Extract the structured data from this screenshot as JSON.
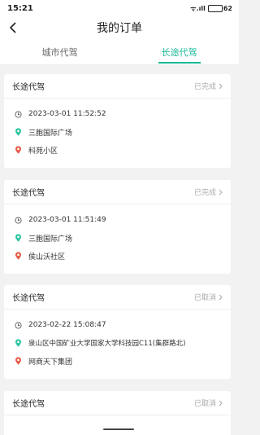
{
  "status_bar": {
    "time": "15:21",
    "signal_text": "ᯤ.ıll",
    "battery_level": "62"
  },
  "header": {
    "title": "我的订单"
  },
  "tabs": [
    {
      "label": "城市代驾",
      "active": false
    },
    {
      "label": "长途代驾",
      "active": true
    }
  ],
  "orders": [
    {
      "type": "长途代驾",
      "status": "已完成",
      "time": "2023-03-01 11:52:52",
      "start": "三胞国际广场",
      "end": "科苑小区"
    },
    {
      "type": "长途代驾",
      "status": "已完成",
      "time": "2023-03-01 11:51:49",
      "start": "三胞国际广场",
      "end": "侯山沃社区"
    },
    {
      "type": "长途代驾",
      "status": "已取消",
      "time": "2023-02-22 15:08:47",
      "start": "泉山区中国矿业大学国家大学科技园C11(集群路北)",
      "end": "网商天下集团"
    },
    {
      "type": "长途代驾",
      "status": "已取消"
    }
  ],
  "colors": {
    "accent": "#19b999",
    "start_dot": "#2ec4a2",
    "end_dot": "#e85c4a"
  }
}
